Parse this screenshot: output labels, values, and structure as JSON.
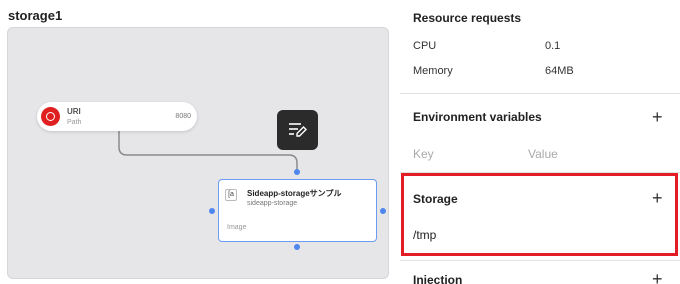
{
  "canvas": {
    "title": "storage1",
    "uri_node": {
      "name": "URI",
      "path": "Path",
      "port": "8080"
    },
    "edit_button": {
      "icon": "edit-notes-icon"
    },
    "app_node": {
      "name": "Sideapp-storageサンプル",
      "subtitle": "sideapp-storage",
      "type": "Image"
    }
  },
  "panel": {
    "resource_requests": {
      "title": "Resource requests",
      "rows": [
        {
          "key": "CPU",
          "value": "0.1"
        },
        {
          "key": "Memory",
          "value": "64MB"
        }
      ]
    },
    "environment_variables": {
      "title": "Environment variables",
      "key_placeholder": "Key",
      "value_placeholder": "Value"
    },
    "storage": {
      "title": "Storage",
      "path": "/tmp"
    },
    "injection": {
      "title": "Injection"
    }
  },
  "colors": {
    "accent": "#4f86ee",
    "highlight": "#e31c25",
    "uri_badge": "#e02020"
  }
}
